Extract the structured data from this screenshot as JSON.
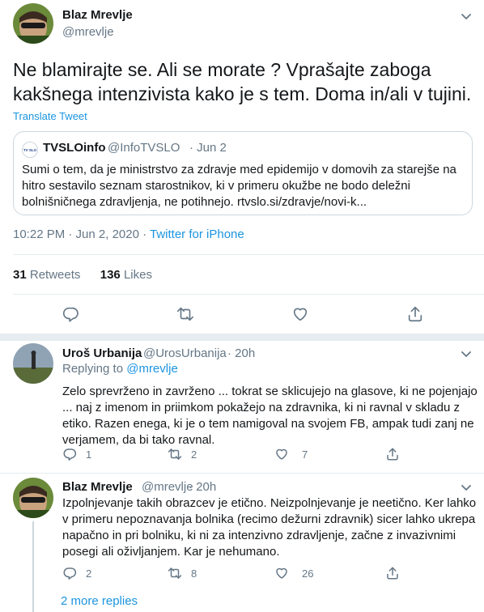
{
  "main_tweet": {
    "name": "Blaz Mrevlje",
    "handle": "@mrevlje",
    "text_line1": "Ne blamirajte se. Ali se morate ? Vprašajte zaboga",
    "text_line2": "kakšnega intenzivista kako je s tem. Doma in/ali v tujini.",
    "translate": "Translate Tweet",
    "time": "10:22 PM · Jun 2, 2020 · ",
    "client": "Twitter for iPhone",
    "retweets_count": "31",
    "retweets_label": "Retweets",
    "likes_count": "136",
    "likes_label": "Likes"
  },
  "quote": {
    "logo_text": "TV SLO",
    "name": "TVSLOinfo",
    "handle": "@InfoTVSLO",
    "date": "· Jun 2",
    "line1": "Sumi o tem, da je ministrstvo za zdravje med epidemijo v domovih za starejše na",
    "line2": "hitro sestavilo seznam starostnikov, ki v primeru okužbe ne bodo deležni",
    "line3": "bolnišničnega zdravljenja, ne potihnejo. rtvslo.si/zdravje/novi-k..."
  },
  "reply1": {
    "name": "Uroš Urbanija",
    "handle": "@UrosUrbanija",
    "time": "· 20h",
    "replying_to": "Replying to ",
    "replying_handle": "@mrevlje",
    "line1": "Zelo sprevrženo in zavrženo ... tokrat se sklicujejo na glasove, ki ne pojenjajo",
    "line2": "... naj z imenom in priimkom pokažejo na zdravnika, ki ni ravnal v skladu z",
    "line3": "etiko. Razen enega, ki je o tem namigoval na svojem FB, ampak tudi zanj ne",
    "line4": "verjamem, da bi tako ravnal.",
    "reply_count": "1",
    "retweet_count": "2",
    "like_count": "7"
  },
  "reply2": {
    "name": "Blaz Mrevlje",
    "handle": "@mrevlje",
    "time": "· 20h",
    "line1": "Izpolnjevanje takih obrazcev je etično. Neizpolnjevanje je neetično. Ker lahko",
    "line2": "v primeru nepoznavanja bolnika (recimo dežurni zdravnik) sicer lahko ukrepa",
    "line3": "napačno in pri bolniku, ki ni za intenzivno zdravljenje, začne z invazivnimi",
    "line4": "posegi ali oživljanjem. Kar je nehumano.",
    "reply_count": "2",
    "retweet_count": "8",
    "like_count": "26"
  },
  "more_replies": "2 more replies",
  "colors": {
    "accent": "#1b95e0",
    "text": "#14171a",
    "secondary": "#657786",
    "border": "#e6ecf0"
  }
}
